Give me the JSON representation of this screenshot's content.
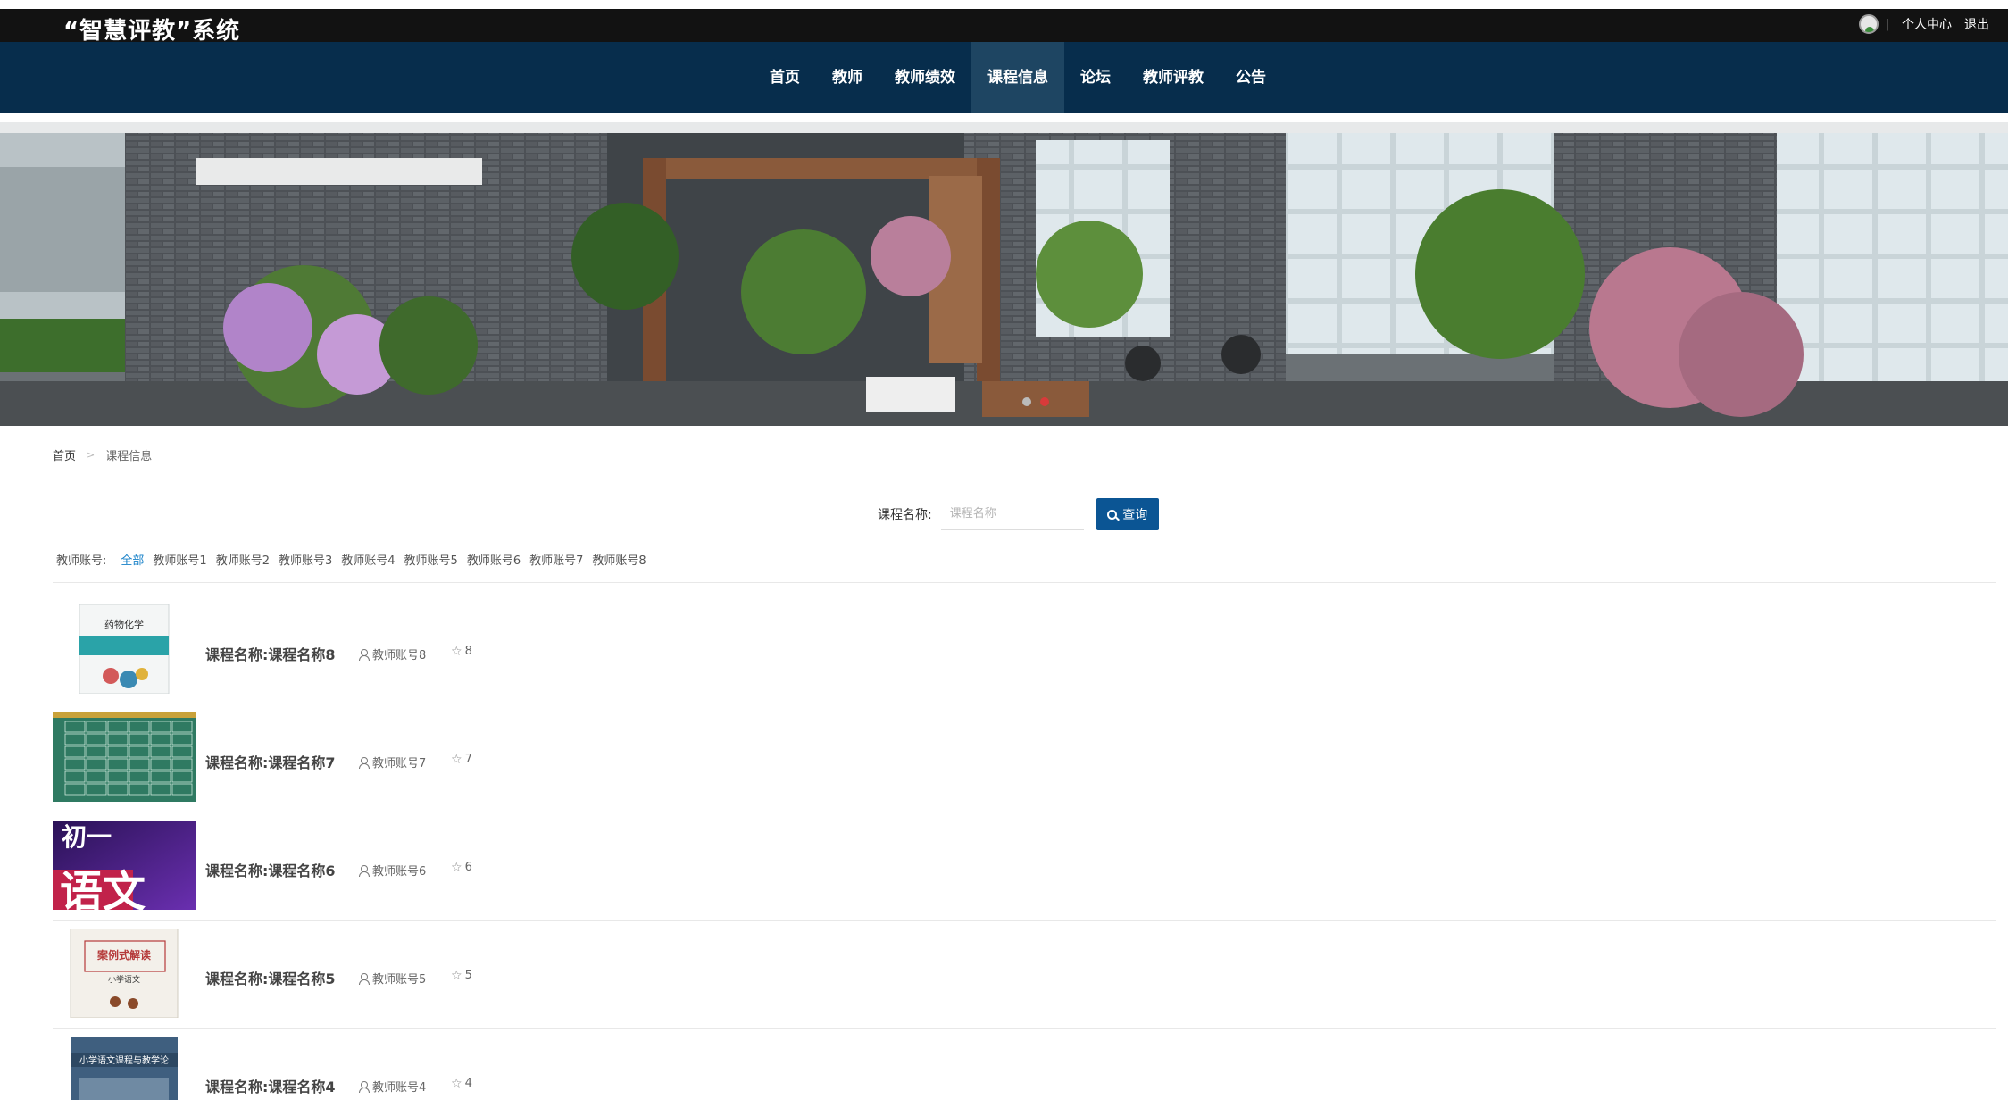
{
  "header": {
    "site_title": "“智慧评教”系统",
    "personal_center": "个人中心",
    "logout": "退出"
  },
  "nav": {
    "items": [
      "首页",
      "教师",
      "教师绩效",
      "课程信息",
      "论坛",
      "教师评教",
      "公告"
    ],
    "active_index": 3
  },
  "breadcrumb": {
    "home": "首页",
    "separator": ">",
    "current": "课程信息"
  },
  "search": {
    "label": "课程名称:",
    "placeholder": "课程名称",
    "button": "查询"
  },
  "filter": {
    "label": "教师账号:",
    "options": [
      "全部",
      "教师账号1",
      "教师账号2",
      "教师账号3",
      "教师账号4",
      "教师账号5",
      "教师账号6",
      "教师账号7",
      "教师账号8"
    ],
    "active_index": 0
  },
  "courses": [
    {
      "title": "课程名称:课程名称8",
      "teacher": "教师账号8",
      "score": "8",
      "cover": "medicinal-chemistry-book-cover",
      "cover_text": "药物化学"
    },
    {
      "title": "课程名称:课程名称7",
      "teacher": "教师账号7",
      "score": "7",
      "cover": "green-chalkboard-timetable"
    },
    {
      "title": "课程名称:课程名称6",
      "teacher": "教师账号6",
      "score": "6",
      "cover": "purple-chinese-poster",
      "cover_text": "初一 语文"
    },
    {
      "title": "课程名称:课程名称5",
      "teacher": "教师账号5",
      "score": "5",
      "cover": "case-study-book-cover",
      "cover_text": "案例式解读 小学语文"
    },
    {
      "title": "课程名称:课程名称4",
      "teacher": "教师账号4",
      "score": "4",
      "cover": "primary-chinese-curriculum-book",
      "cover_text": "小学语文课程与教学论"
    }
  ],
  "colors": {
    "topbar": "#121212",
    "navbar": "#072d4c",
    "nav_active": "#1e4562",
    "primary_button": "#0b5594",
    "filter_active": "#1781c8"
  }
}
